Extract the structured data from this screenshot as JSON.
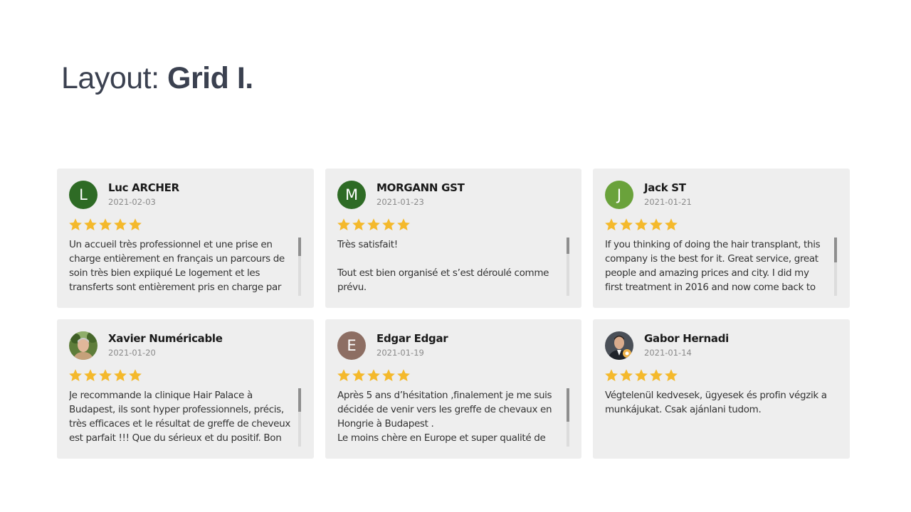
{
  "page": {
    "title_prefix": "Layout: ",
    "title_emphasis": "Grid I."
  },
  "colors": {
    "star": "#f4b92c",
    "card_background": "#eeeeee",
    "title": "#3b4150"
  },
  "reviews": [
    {
      "name": "Luc ARCHER",
      "date": "2021-02-03",
      "rating": 5,
      "avatar_letter": "L",
      "avatar_color": "#2e6b25",
      "avatar_icon": "letter",
      "text": "Un accueil très professionnel et une prise en charge entièrement en français un parcours de soin très bien expiiqué Le logement et les transferts sont entièrement pris en charge par",
      "scrollable": true,
      "scroll_thumb_fraction": 0.32
    },
    {
      "name": "MORGANN GST",
      "date": "2021-01-23",
      "rating": 5,
      "avatar_letter": "M",
      "avatar_color": "#2e6b25",
      "avatar_icon": "letter",
      "text": "Très satisfait!\n\nTout est bien organisé et s’est déroulé comme prévu.",
      "scrollable": true,
      "scroll_thumb_fraction": 0.28
    },
    {
      "name": "Jack ST",
      "date": "2021-01-21",
      "rating": 5,
      "avatar_letter": "J",
      "avatar_color": "#6aa23b",
      "avatar_icon": "letter",
      "text": "If you thinking of doing the hair transplant, this company is the best for it. Great service, great people and amazing prices and city. I did my first treatment in 2016 and now come back to",
      "scrollable": true,
      "scroll_thumb_fraction": 0.43
    },
    {
      "name": "Xavier Numéricable",
      "date": "2021-01-20",
      "rating": 5,
      "avatar_letter": "",
      "avatar_color": "#6b8a4a",
      "avatar_icon": "photo-portrait-outdoor",
      "text": "Je recommande la clinique Hair Palace à Budapest, ils sont hyper professionnels, précis, très efficaces et le résultat de greffe de cheveux est parfait !!! Que du sérieux et du positif. Bon",
      "scrollable": true,
      "scroll_thumb_fraction": 0.4
    },
    {
      "name": "Edgar Edgar",
      "date": "2021-01-19",
      "rating": 5,
      "avatar_letter": "E",
      "avatar_color": "#8d6e63",
      "avatar_icon": "letter",
      "text": "Après 5 ans d’hésitation ,finalement je me suis décidée de venir vers les greffe de chevaux en Hongrie à Budapest .\nLe moins chère en Europe et super qualité de",
      "scrollable": true,
      "scroll_thumb_fraction": 0.57
    },
    {
      "name": "Gabor Hernadi",
      "date": "2021-01-14",
      "rating": 5,
      "avatar_letter": "",
      "avatar_color": "#2b2b2b",
      "avatar_icon": "photo-portrait-suit",
      "text": "Végtelenül kedvesek, ügyesek és profin végzik a munkájukat. Csak ajánlani tudom.",
      "scrollable": false,
      "scroll_thumb_fraction": 0
    }
  ]
}
